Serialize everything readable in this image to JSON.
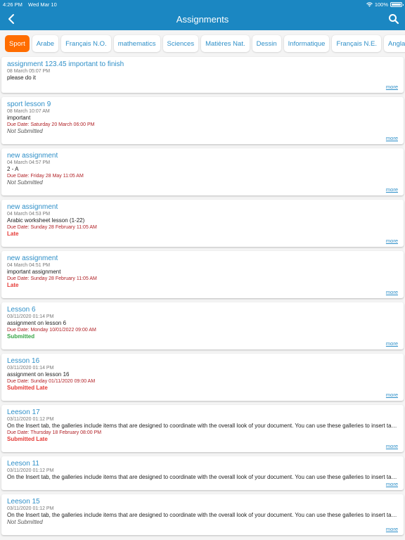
{
  "status_bar": {
    "time": "4:26 PM",
    "date": "Wed Mar 10",
    "battery": "100%"
  },
  "header": {
    "title": "Assignments"
  },
  "tabs": [
    {
      "label": "Sport",
      "active": true
    },
    {
      "label": "Arabe"
    },
    {
      "label": "Français N.O."
    },
    {
      "label": "mathematics"
    },
    {
      "label": "Sciences"
    },
    {
      "label": "Matières Nat."
    },
    {
      "label": "Dessin"
    },
    {
      "label": "Informatique"
    },
    {
      "label": "Français N.E."
    },
    {
      "label": "Anglais"
    }
  ],
  "more_label": "more",
  "assignments": [
    {
      "title": "assignment 123.45 important to finish",
      "date": "08 March   05:07 PM",
      "desc": "please do it",
      "due": "",
      "status": "",
      "status_type": "",
      "gap": true
    },
    {
      "title": "sport lesson 9",
      "date": "08 March   10:07 AM",
      "desc": "important",
      "due": "Due Date:  Saturday 20 March  06:00 PM",
      "status": "Not Submitted",
      "status_type": "not"
    },
    {
      "title": "new assignment",
      "date": "04 March   04:57 PM",
      "desc": "2 - A",
      "due": "Due Date:  Friday 28 May 11:05 AM",
      "status": "Not Submitted",
      "status_type": "not"
    },
    {
      "title": "new assignment",
      "date": "04 March   04:53 PM",
      "desc": "Arabic worksheet lesson (1-22)",
      "due": "Due Date:  Sunday 28 February 11:05 AM",
      "status": "Late",
      "status_type": "late"
    },
    {
      "title": "new assignment",
      "date": "04 March   04:51 PM",
      "desc": "important  assignment",
      "due": "Due Date:  Sunday 28 February 11:05 AM",
      "status": "Late",
      "status_type": "late"
    },
    {
      "title": "Lesson 6",
      "date": "03/11/2020  01:14 PM",
      "desc": "assignment on lesson 6",
      "due": "Due Date:  Monday 10/01/2022 09:00 AM",
      "status": "Submitted",
      "status_type": "ok"
    },
    {
      "title": "Lesson 16",
      "date": "03/11/2020  01:14 PM",
      "desc": "assignment on lesson 16",
      "due": "Due Date:  Sunday 01/11/2020 09:00 AM",
      "status": "Submitted Late",
      "status_type": "late"
    },
    {
      "title": "Leeson 17",
      "date": "03/11/2020  01:12 PM",
      "desc": "On the Insert tab, the galleries include items that are designed to coordinate with the overall look of your document. You can use these galleries to insert table...",
      "due": "Due Date:  Thursday 18 February 08:00 PM",
      "status": "Submitted Late",
      "status_type": "late"
    },
    {
      "title": "Leeson 11",
      "date": "03/11/2020  01:12 PM",
      "desc": "On the Insert tab, the galleries include items that are designed to coordinate with the overall look of your document. You can use these galleries to insert table...",
      "due": "",
      "status": "",
      "status_type": ""
    },
    {
      "title": "Leeson 15",
      "date": "03/11/2020  01:12 PM",
      "desc": "On the Insert tab, the galleries include items that are designed to coordinate with the overall look of your document. You can use these galleries to insert table...",
      "due": "",
      "status": "Not Submitted",
      "status_type": "not"
    }
  ]
}
